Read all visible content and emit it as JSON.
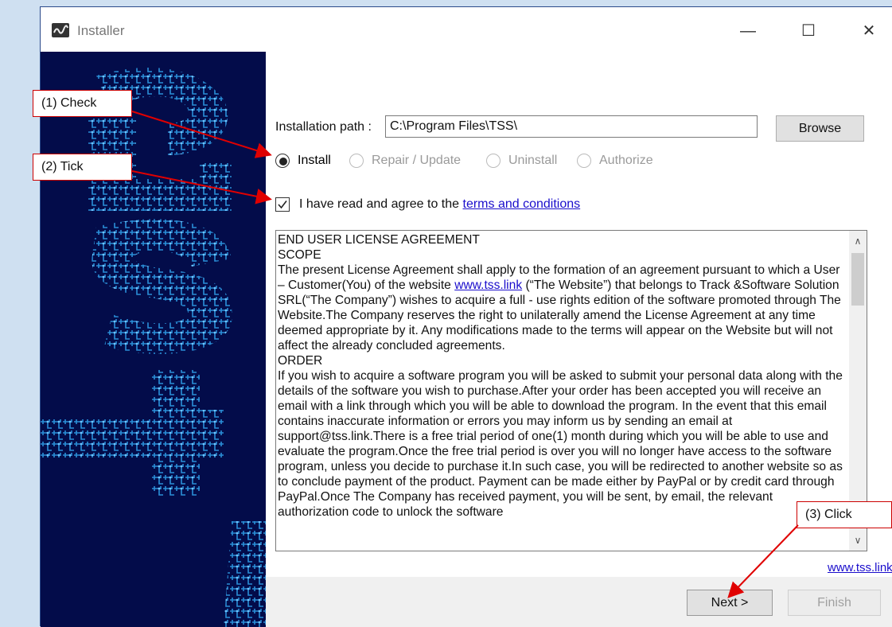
{
  "window": {
    "title": "Installer",
    "controls": {
      "minimize": "—",
      "maximize": "☐",
      "close": "✕"
    }
  },
  "install_path": {
    "label": "Installation path :",
    "value": "C:\\Program Files\\TSS\\",
    "browse_label": "Browse"
  },
  "modes": [
    {
      "label": "Install",
      "selected": true,
      "enabled": true
    },
    {
      "label": "Repair / Update",
      "selected": false,
      "enabled": false
    },
    {
      "label": "Uninstall",
      "selected": false,
      "enabled": false
    },
    {
      "label": "Authorize",
      "selected": false,
      "enabled": false
    }
  ],
  "agree": {
    "checked": true,
    "text": "I have read and agree to the",
    "link": "terms and conditions"
  },
  "eula": {
    "heading": "END USER LICENSE AGREEMENT",
    "scope_heading": "SCOPE",
    "scope_before_link": "The present License Agreement shall apply to the formation of an agreement pursuant to which a User – Customer(You) of the website",
    "scope_link": "www.tss.link",
    "scope_after_link": " (“The Website”) that belongs to Track &Software Solution SRL(“The Company”) wishes to acquire a full - use rights edition of the software promoted through The Website.The Company reserves the right to unilaterally amend the License Agreement at any time deemed appropriate by it. Any modifications made to the terms will appear on the Website but will not affect the already concluded agreements.",
    "order_heading": "ORDER",
    "order_text": "If you wish to acquire a software program you will be asked to submit your personal data along with the details of the software you wish to purchase.After your order has been accepted you will receive an email with a link through which you will be able to download the program. In the event that this email contains inaccurate information or errors you may inform us by sending an email at support@tss.link.There is a free trial period of one(1) month during which you will be able to use and evaluate the program.Once the free trial period is over you will no longer have access to the software program, unless you decide to purchase it.In such case, you will be redirected to another website so as to conclude payment of the product. Payment can be made either by PayPal or by credit card through PayPal.Once The Company has received payment, you will be sent, by email, the relevant authorization code to unlock the software"
  },
  "site_link": "www.tss.link",
  "buttons": {
    "next": "Next >",
    "finish": "Finish"
  },
  "callouts": {
    "check": "(1) Check",
    "tick": "(2) Tick",
    "click": "(3) Click"
  },
  "colors": {
    "side_panel": "#030c4a",
    "circuit": "#2a8fd8",
    "annotation": "#e00000",
    "link": "#1a0dcc"
  }
}
